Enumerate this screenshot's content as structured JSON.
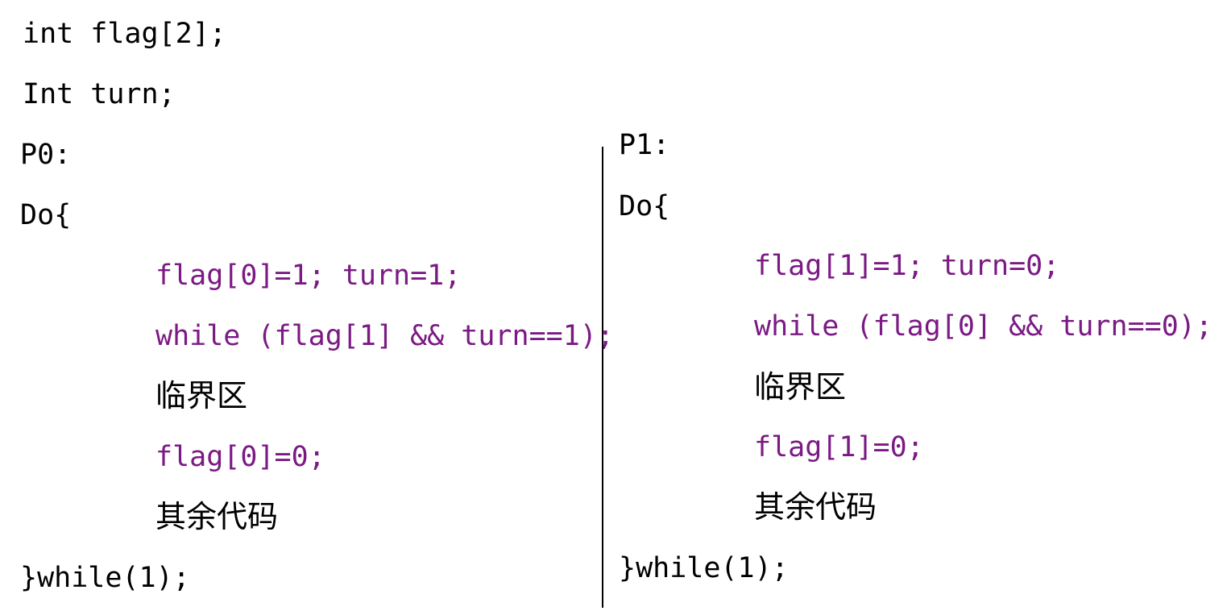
{
  "colors": {
    "code": "#7b1a84",
    "text": "#000000",
    "background": "#ffffff"
  },
  "declarations": [
    "int flag[2];",
    "Int turn;"
  ],
  "p0": {
    "label": "P0:",
    "do_open": "Do{",
    "set_flags": "flag[0]=1; turn=1;",
    "wait_loop": "while (flag[1] && turn==1);",
    "critical_section": "临界区",
    "reset_flag": "flag[0]=0;",
    "remainder": "其余代码",
    "do_close": "}while(1);"
  },
  "p1": {
    "label": "P1:",
    "do_open": "Do{",
    "set_flags": "flag[1]=1; turn=0;",
    "wait_loop": "while (flag[0] && turn==0);",
    "critical_section": "临界区",
    "reset_flag": "flag[1]=0;",
    "remainder": "其余代码",
    "do_close": "}while(1);"
  }
}
